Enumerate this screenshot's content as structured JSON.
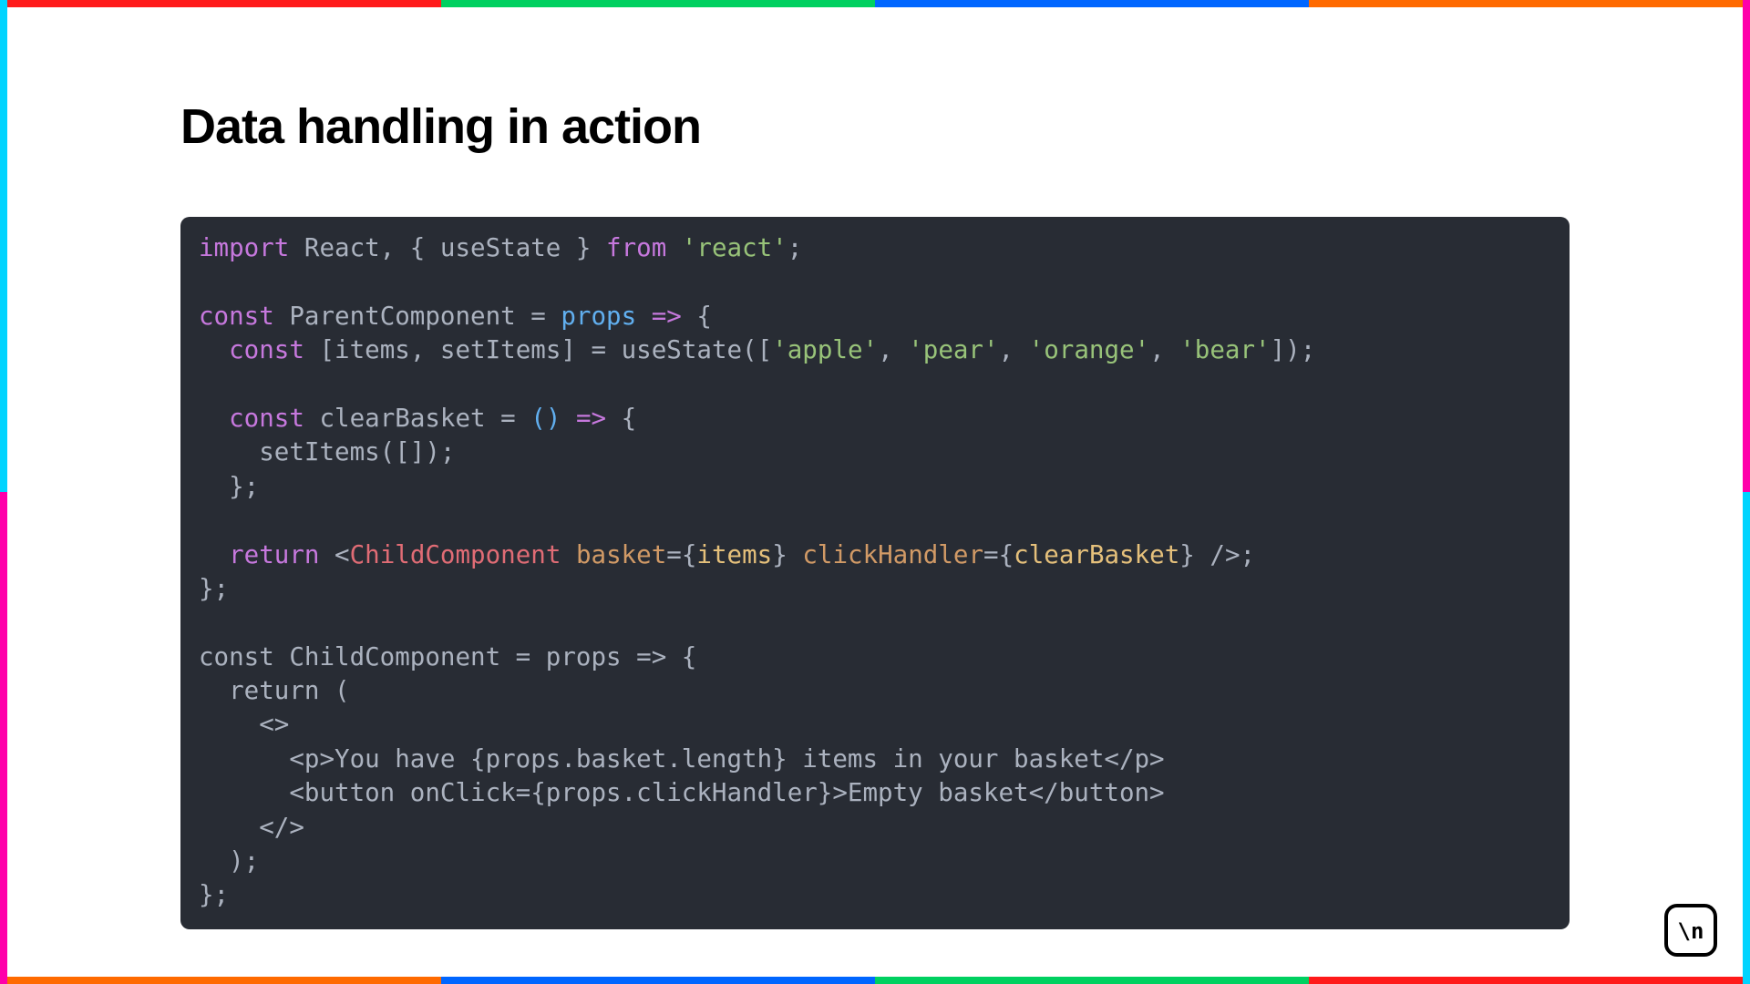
{
  "title": "Data handling in action",
  "colors": {
    "red": "#ff1a1a",
    "magenta": "#ff00aa",
    "cyan": "#00d4ff",
    "blue": "#0066ff",
    "green": "#00d060",
    "yellow": "#ffe600",
    "orange": "#ff6a00",
    "code_bg": "#282c34",
    "code_fg": "#abb2bf",
    "tok_keyword": "#c678dd",
    "tok_string": "#98c379",
    "tok_function": "#61afef",
    "tok_tag": "#e06c75",
    "tok_attr": "#d19a66",
    "tok_ident": "#e5c07b"
  },
  "logo_text": "\\n",
  "code": {
    "tokens": [
      [
        [
          "import",
          "kw"
        ],
        [
          " React, { useState } ",
          "def"
        ],
        [
          "from",
          "kw"
        ],
        [
          " ",
          "def"
        ],
        [
          "'react'",
          "str"
        ],
        [
          ";",
          "def"
        ]
      ],
      [
        [
          "",
          "def"
        ]
      ],
      [
        [
          "const",
          "kw"
        ],
        [
          " ParentComponent = ",
          "def"
        ],
        [
          "props",
          "fn"
        ],
        [
          " ",
          "def"
        ],
        [
          "=>",
          "arrow"
        ],
        [
          " {",
          "def"
        ]
      ],
      [
        [
          "  ",
          "def"
        ],
        [
          "const",
          "kw"
        ],
        [
          " [items, setItems] = useState([",
          "def"
        ],
        [
          "'apple'",
          "str"
        ],
        [
          ", ",
          "def"
        ],
        [
          "'pear'",
          "str"
        ],
        [
          ", ",
          "def"
        ],
        [
          "'orange'",
          "str"
        ],
        [
          ", ",
          "def"
        ],
        [
          "'bear'",
          "str"
        ],
        [
          "]);",
          "def"
        ]
      ],
      [
        [
          "",
          "def"
        ]
      ],
      [
        [
          "  ",
          "def"
        ],
        [
          "const",
          "kw"
        ],
        [
          " clearBasket = ",
          "def"
        ],
        [
          "()",
          "fn"
        ],
        [
          " ",
          "def"
        ],
        [
          "=>",
          "arrow"
        ],
        [
          " {",
          "def"
        ]
      ],
      [
        [
          "    setItems([]);",
          "def"
        ]
      ],
      [
        [
          "  };",
          "def"
        ]
      ],
      [
        [
          "",
          "def"
        ]
      ],
      [
        [
          "  ",
          "def"
        ],
        [
          "return",
          "kw"
        ],
        [
          " ",
          "def"
        ],
        [
          "<",
          "angle"
        ],
        [
          "ChildComponent",
          "tag"
        ],
        [
          " ",
          "def"
        ],
        [
          "basket",
          "attr"
        ],
        [
          "=",
          "def"
        ],
        [
          "{",
          "def"
        ],
        [
          "items",
          "ident"
        ],
        [
          "}",
          "def"
        ],
        [
          " ",
          "def"
        ],
        [
          "clickHandler",
          "attr"
        ],
        [
          "=",
          "def"
        ],
        [
          "{",
          "def"
        ],
        [
          "clearBasket",
          "ident"
        ],
        [
          "}",
          "def"
        ],
        [
          " ",
          "def"
        ],
        [
          "/>",
          "angle"
        ],
        [
          ";",
          "def"
        ]
      ],
      [
        [
          "};",
          "def"
        ]
      ],
      [
        [
          "",
          "def"
        ]
      ],
      [
        [
          "const ChildComponent = props => {",
          "def"
        ]
      ],
      [
        [
          "  return (",
          "def"
        ]
      ],
      [
        [
          "    <>",
          "def"
        ]
      ],
      [
        [
          "      <p>You have {props.basket.length} items in your basket</p>",
          "def"
        ]
      ],
      [
        [
          "      <button onClick={props.clickHandler}>Empty basket</button>",
          "def"
        ]
      ],
      [
        [
          "    </>",
          "def"
        ]
      ],
      [
        [
          "  );",
          "def"
        ]
      ],
      [
        [
          "};",
          "def"
        ]
      ]
    ]
  }
}
